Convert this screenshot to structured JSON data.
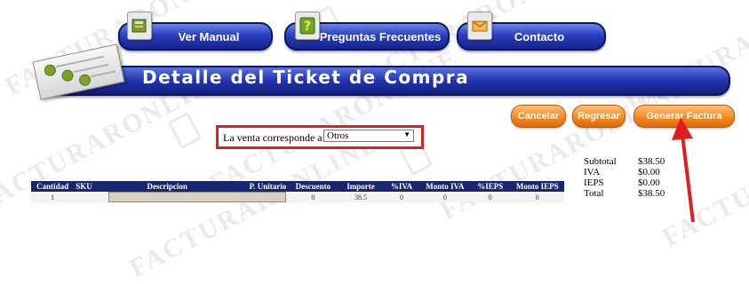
{
  "watermark_text": "FACTURARONLINE",
  "nav": {
    "ver_manual": "Ver Manual",
    "preguntas": "Preguntas Frecuentes",
    "contacto": "Contacto"
  },
  "header": {
    "title": "Detalle del Ticket de Compra"
  },
  "actions": {
    "cancelar": "Cancelar",
    "regresar": "Regresar",
    "generar": "Generar Factura"
  },
  "venta": {
    "label": "La venta corresponde a:",
    "selected": "Otros"
  },
  "totals": [
    {
      "label": "Subtotal",
      "value": "$38.50"
    },
    {
      "label": "IVA",
      "value": "$0.00"
    },
    {
      "label": "IEPS",
      "value": "$0.00"
    },
    {
      "label": "Total",
      "value": "$38.50"
    }
  ],
  "table": {
    "headers": [
      "Cantidad",
      "SKU",
      "Descripcion",
      "P. Unitario",
      "Descuento",
      "Importe",
      "%IVA",
      "Monto IVA",
      "%IEPS",
      "Monto IEPS"
    ],
    "rows": [
      [
        "1",
        "",
        "",
        "",
        "0",
        "38.5",
        "0",
        "0",
        "0",
        "0"
      ]
    ]
  },
  "colors": {
    "nav_blue": "#2334b2",
    "action_orange": "#f58a1f",
    "highlight_red": "#e01e1e",
    "table_header": "#18256f"
  }
}
